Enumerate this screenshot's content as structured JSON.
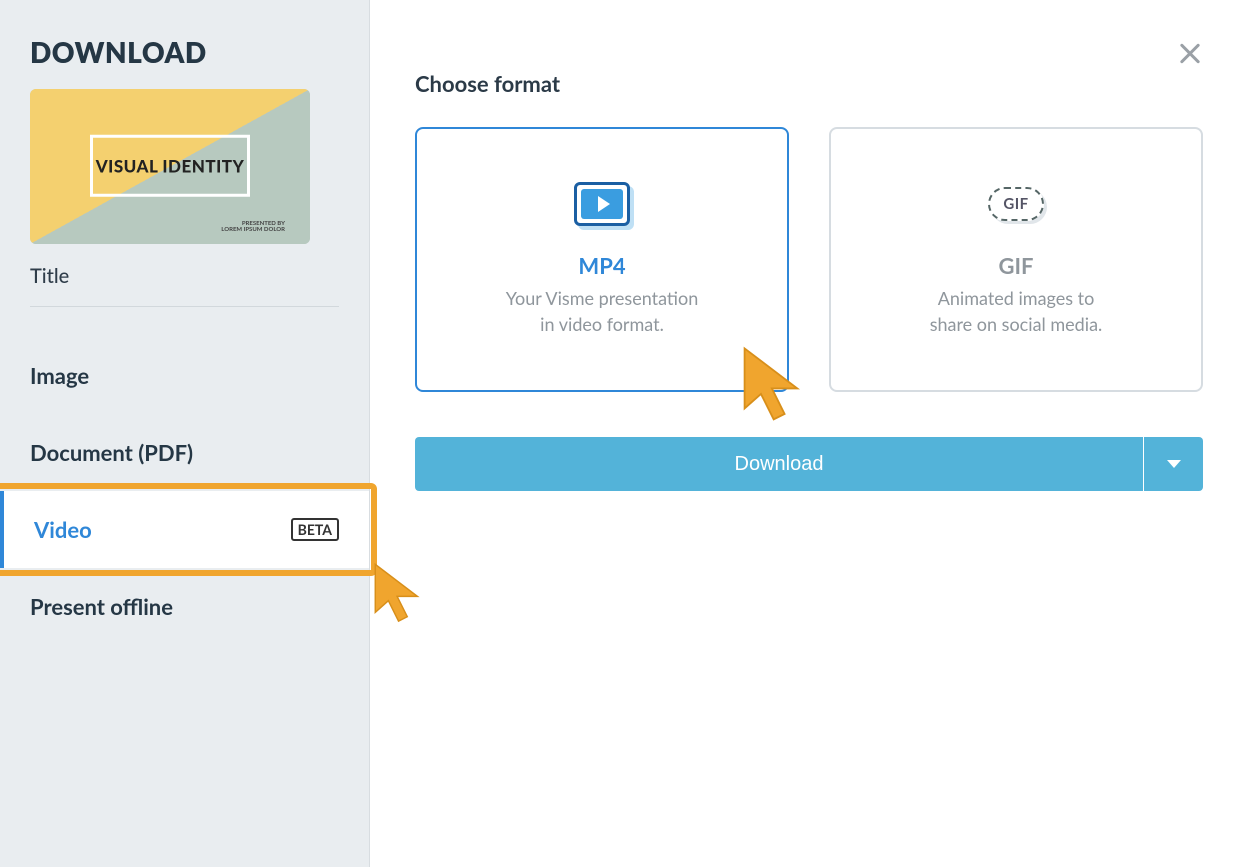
{
  "sidebar": {
    "heading": "DOWNLOAD",
    "thumb": {
      "title": "VISUAL IDENTITY",
      "sub1": "PRESENTED BY",
      "sub2": "LOREM IPSUM DOLOR"
    },
    "title_label": "Title",
    "items": {
      "image": "Image",
      "document": "Document (PDF)",
      "video": "Video",
      "video_badge": "BETA",
      "present": "Present offline"
    }
  },
  "main": {
    "section_title": "Choose format",
    "cards": {
      "mp4": {
        "title": "MP4",
        "desc_l1": "Your Visme presentation",
        "desc_l2": "in video format."
      },
      "gif": {
        "title": "GIF",
        "icon_label": "GIF",
        "desc_l1": "Animated images to",
        "desc_l2": "share on social media."
      }
    },
    "download_label": "Download"
  }
}
